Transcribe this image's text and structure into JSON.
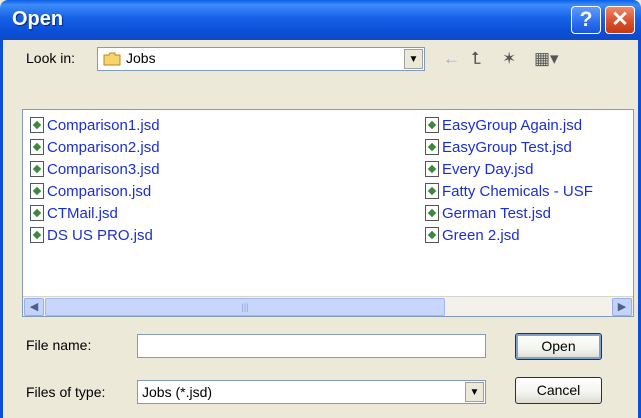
{
  "window": {
    "title": "Open",
    "help_glyph": "?",
    "close_glyph": "✕"
  },
  "lookin": {
    "label": "Look in:",
    "value": "Jobs"
  },
  "toolbar": {
    "back_glyph": "←",
    "up_glyph": "⮤",
    "newfolder_glyph": "✶",
    "views_glyph": "▦▾"
  },
  "files": {
    "column_a": [
      "Comparison1.jsd",
      "Comparison2.jsd",
      "Comparison3.jsd",
      "Comparison.jsd",
      "CTMail.jsd",
      "DS US PRO.jsd"
    ],
    "column_b": [
      "EasyGroup Again.jsd",
      "EasyGroup Test.jsd",
      "Every Day.jsd",
      "Fatty Chemicals - USF",
      "German Test.jsd",
      "Green 2.jsd"
    ]
  },
  "form": {
    "filename_label": "File name:",
    "filename_value": "",
    "filetype_label": "Files of type:",
    "filetype_value": "Jobs (*.jsd)"
  },
  "buttons": {
    "open": "Open",
    "cancel": "Cancel"
  },
  "icons": [
    "help-icon",
    "close-icon",
    "folder-icon",
    "back-icon",
    "up-folder-icon",
    "new-folder-icon",
    "views-icon",
    "jsd-file-icon"
  ]
}
